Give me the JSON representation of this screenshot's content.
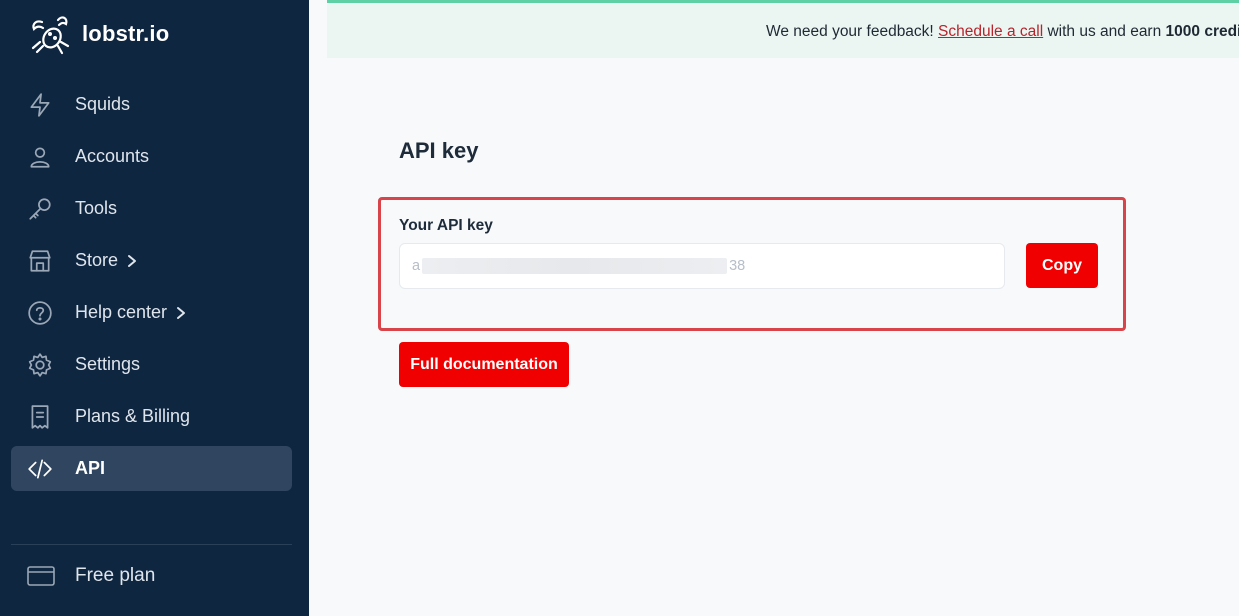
{
  "brand": {
    "name": "lobstr.io",
    "logo": "lobster-logo"
  },
  "sidebar": {
    "items": [
      {
        "label": "Squids",
        "icon": "bolt-icon"
      },
      {
        "label": "Accounts",
        "icon": "user-icon"
      },
      {
        "label": "Tools",
        "icon": "key-icon"
      },
      {
        "label": "Store",
        "icon": "store-icon"
      },
      {
        "label": "Help center",
        "icon": "help-icon"
      },
      {
        "label": "Settings",
        "icon": "gear-icon"
      },
      {
        "label": "Plans & Billing",
        "icon": "receipt-icon"
      },
      {
        "label": "API",
        "icon": "code-icon"
      }
    ],
    "active": "API",
    "plan_label": "Free plan"
  },
  "banner": {
    "prefix": "We need your feedback! ",
    "link": "Schedule a call",
    "middle": " with us and earn ",
    "bold": "1000 credi"
  },
  "page": {
    "title": "API key"
  },
  "api_key": {
    "label": "Your API key",
    "value_start": "a",
    "value_end": "38",
    "copy_label": "Copy"
  },
  "docs": {
    "button_label": "Full documentation"
  },
  "colors": {
    "sidebar_bg": "#0f2640",
    "accent_red": "#f00000",
    "highlight_border": "#d9434a",
    "banner_bg": "#ebf6f3"
  }
}
